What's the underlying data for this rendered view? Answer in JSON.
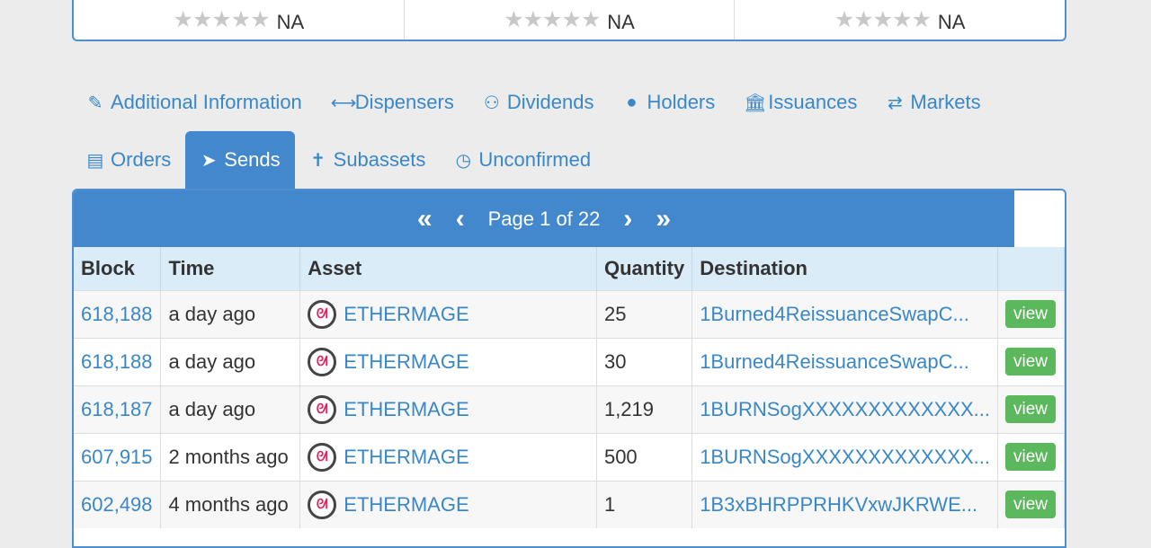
{
  "ratings": [
    {
      "stars": "★★★★★",
      "value": "NA"
    },
    {
      "stars": "★★★★★",
      "value": "NA"
    },
    {
      "stars": "★★★★★",
      "value": "NA"
    }
  ],
  "tabs_row1": [
    {
      "icon": "✎",
      "label": "Additional Information"
    },
    {
      "icon": "⟷",
      "label": "Dispensers"
    },
    {
      "icon": "⚇",
      "label": "Dividends"
    },
    {
      "icon": "●",
      "label": "Holders"
    },
    {
      "icon": "🏛",
      "label": "Issuances"
    },
    {
      "icon": "⇄",
      "label": "Markets"
    }
  ],
  "tabs_row2": [
    {
      "icon": "▤",
      "label": "Orders"
    },
    {
      "icon": "➤",
      "label": "Sends"
    },
    {
      "icon": "✝",
      "label": "Subassets"
    },
    {
      "icon": "◷",
      "label": "Unconfirmed"
    }
  ],
  "pager": {
    "first": "«",
    "prev": "‹",
    "text": "Page 1 of 22",
    "next": "›",
    "last": "»"
  },
  "table": {
    "headers": [
      "Block",
      "Time",
      "Asset",
      "Quantity",
      "Destination",
      ""
    ],
    "rows": [
      {
        "block": "618,188",
        "time": "a day ago",
        "asset": "ETHERMAGE",
        "quantity": "25",
        "destination": "1Burned4ReissuanceSwapC...",
        "action": "view"
      },
      {
        "block": "618,188",
        "time": "a day ago",
        "asset": "ETHERMAGE",
        "quantity": "30",
        "destination": "1Burned4ReissuanceSwapC...",
        "action": "view"
      },
      {
        "block": "618,187",
        "time": "a day ago",
        "asset": "ETHERMAGE",
        "quantity": "1,219",
        "destination": "1BURNSogXXXXXXXXXXXXX...",
        "action": "view"
      },
      {
        "block": "607,915",
        "time": "2 months ago",
        "asset": "ETHERMAGE",
        "quantity": "500",
        "destination": "1BURNSogXXXXXXXXXXXXX...",
        "action": "view"
      },
      {
        "block": "602,498",
        "time": "4 months ago",
        "asset": "ETHERMAGE",
        "quantity": "1",
        "destination": "1B3xBHRPPRHKVxwJKRWE...",
        "action": "view"
      }
    ]
  },
  "colors": {
    "accent": "#4388cc",
    "link": "#3a87c8",
    "view": "#5cb85c"
  }
}
